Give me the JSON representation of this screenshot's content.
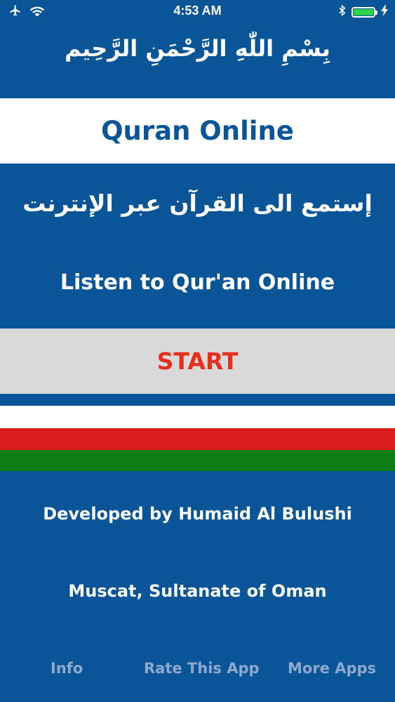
{
  "status_bar": {
    "time": "4:53 AM",
    "battery_level": 1.0,
    "icons": [
      "airplane-icon",
      "wifi-icon",
      "bluetooth-icon",
      "battery-icon",
      "charging-icon"
    ]
  },
  "header": {
    "basmala": "بِسْمِ اللّٰهِ الرَّحْمَنِ الرَّحِيم"
  },
  "title": {
    "text": "Quran Online"
  },
  "subtitle": {
    "arabic": "إستمع الى القرآن عبر الإنترنت",
    "english": "Listen to Qur'an Online"
  },
  "start_button": {
    "label": "START"
  },
  "flag": {
    "colors": [
      "#ffffff",
      "#d91c1c",
      "#0e7e12"
    ]
  },
  "credits": {
    "developer": "Developed by Humaid Al Bulushi",
    "location": "Muscat, Sultanate of Oman"
  },
  "bottom_links": {
    "info": "Info",
    "rate": "Rate This App",
    "more": "More Apps"
  },
  "colors": {
    "background": "#0a5598",
    "start_text": "#e6301f",
    "start_bg": "#d9d9d9",
    "link": "#8ea9cf"
  }
}
